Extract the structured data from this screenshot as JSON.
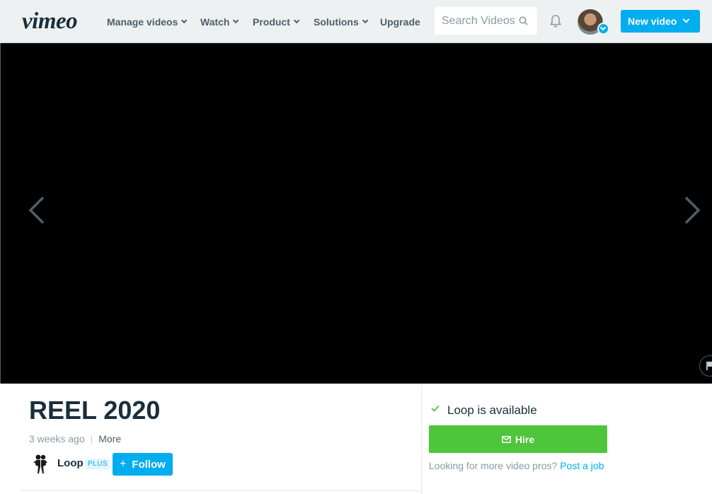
{
  "header": {
    "logo": "vimeo",
    "nav": {
      "manage_videos": "Manage videos",
      "watch": "Watch",
      "product": "Product",
      "solutions": "Solutions",
      "upgrade": "Upgrade"
    },
    "search": {
      "placeholder": "Search Videos"
    },
    "new_video_label": "New video"
  },
  "video": {
    "title": "REEL 2020",
    "posted": "3 weeks ago",
    "more_label": "More",
    "owner": {
      "name": "Loop",
      "badge": "PLUS"
    },
    "follow_label": "Follow"
  },
  "sidebar": {
    "availability": "Loop is available",
    "hire_label": "Hire",
    "more_pros_text": "Looking for more video pros?",
    "post_job_label": "Post a job"
  },
  "colors": {
    "accent": "#00adef",
    "hire_green": "#4ec53a",
    "text_dark": "#1a2e3b"
  }
}
